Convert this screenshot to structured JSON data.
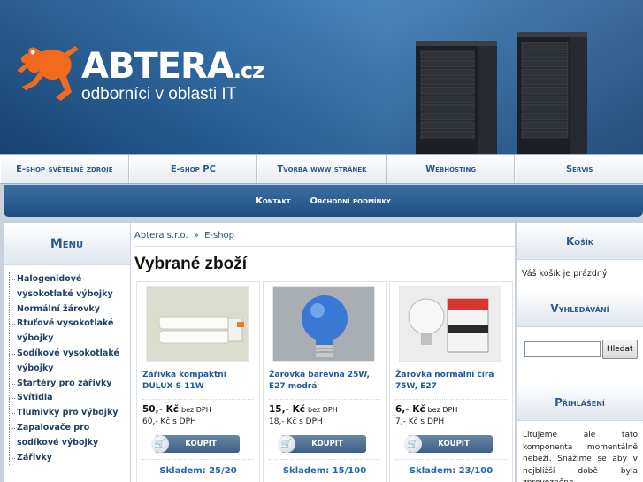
{
  "header": {
    "brand": "ABTERA",
    "tld": ".cz",
    "tagline": "odborníci v oblasti IT"
  },
  "main_nav": [
    {
      "label": "E-shop světelné zdroje"
    },
    {
      "label": "E-shop PC"
    },
    {
      "label": "Tvorba www stránek"
    },
    {
      "label": "Webhosting"
    },
    {
      "label": "Servis"
    }
  ],
  "sub_nav": [
    {
      "label": "Kontakt"
    },
    {
      "label": "Obchodní podmínky"
    }
  ],
  "left": {
    "title": "Menu",
    "items": [
      "Halogenidové vysokotlaké výbojky",
      "Normální žárovky",
      "Rtuťové vysokotlaké výbojky",
      "Sodíkové vysokotlaké výbojky",
      "Startéry pro zářivky",
      "Svítidla",
      "Tlumivky pro výbojky",
      "Zapalovače pro sodíkové výbojky",
      "Zářivky"
    ]
  },
  "center": {
    "breadcrumb": [
      "Abtera s.r.o.",
      "»",
      "E-shop"
    ],
    "title": "Vybrané zboží",
    "products": [
      {
        "name": "Zářivka kompaktní DULUX S 11W",
        "price_excl": "50,- Kč",
        "excl_label": "bez DPH",
        "price_incl": "60,- Kč s DPH",
        "buy_label": "KOUPIT",
        "stock": "Skladem: 25/20"
      },
      {
        "name": "Žarovka barevná 25W, E27 modrá",
        "price_excl": "15,- Kč",
        "excl_label": "bez DPH",
        "price_incl": "18,- Kč s DPH",
        "buy_label": "KOUPIT",
        "stock": "Skladem: 15/100"
      },
      {
        "name": "Žarovka normální čirá 75W, E27",
        "price_excl": "6,- Kč",
        "excl_label": "bez DPH",
        "price_incl": "7,- Kč s DPH",
        "buy_label": "KOUPIT",
        "stock": "Skladem: 23/100"
      }
    ]
  },
  "right": {
    "cart_title": "Košík",
    "cart_text": "Váš košík je prázdný",
    "search_title": "Vyhledávání",
    "search_value": "",
    "search_button": "Hledat",
    "login_title": "Přihlášení",
    "login_text": "Litujeme ale tato komponenta momentálně nebeží. Snažíme se aby v nejbližší době byla zprovozněna."
  },
  "colors": {
    "accent": "#2c5a8f",
    "header_blue": "#2a69a6",
    "stock_blue": "#2667a6"
  }
}
